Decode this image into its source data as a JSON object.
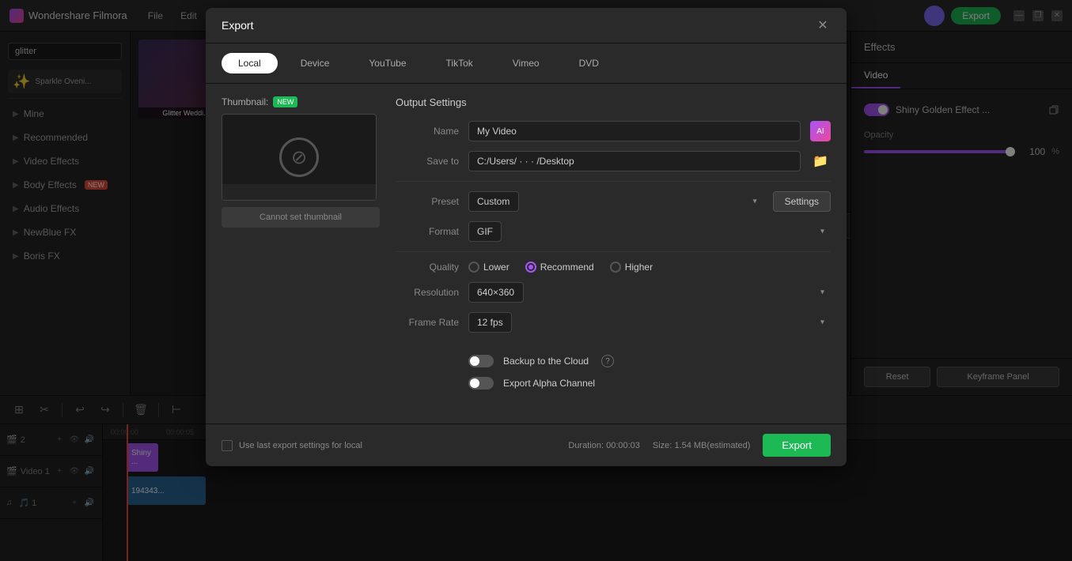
{
  "app": {
    "name": "Wondershare Filmora",
    "menu_items": [
      "File",
      "Edit"
    ]
  },
  "top_bar": {
    "export_button": "Export",
    "window_controls": [
      "—",
      "❐",
      "✕"
    ]
  },
  "sidebar": {
    "items": [
      {
        "id": "mine",
        "label": "Mine",
        "has_arrow": true,
        "badge": null
      },
      {
        "id": "recommended",
        "label": "Recommended",
        "has_arrow": true,
        "badge": null
      },
      {
        "id": "video-effects",
        "label": "Video Effects",
        "has_arrow": true,
        "badge": null
      },
      {
        "id": "body-effects",
        "label": "Body Effects",
        "has_arrow": true,
        "badge": "NEW"
      },
      {
        "id": "audio-effects",
        "label": "Audio Effects",
        "has_arrow": true,
        "badge": null
      },
      {
        "id": "newblue-fx",
        "label": "NewBlue FX",
        "has_arrow": true,
        "badge": null
      },
      {
        "id": "boris-fx",
        "label": "Boris FX",
        "has_arrow": true,
        "badge": null
      }
    ]
  },
  "right_panel": {
    "header": "Effects",
    "tabs": [
      "Video"
    ],
    "effect_name": "Shiny Golden Effect ...",
    "opacity_label": "Opacity",
    "opacity_value": "100",
    "opacity_unit": "%"
  },
  "bottom_buttons": {
    "reset": "Reset",
    "keyframe": "Keyframe Panel"
  },
  "timeline": {
    "track1_label": "Video 1",
    "track1_icon": "🎬",
    "track2_label": "2",
    "clip1_label": "Shiny ...",
    "clip2_label": "194343..."
  },
  "export_modal": {
    "title": "Export",
    "close_icon": "✕",
    "tabs": [
      {
        "id": "local",
        "label": "Local",
        "active": true
      },
      {
        "id": "device",
        "label": "Device",
        "active": false
      },
      {
        "id": "youtube",
        "label": "YouTube",
        "active": false
      },
      {
        "id": "tiktok",
        "label": "TikTok",
        "active": false
      },
      {
        "id": "vimeo",
        "label": "Vimeo",
        "active": false
      },
      {
        "id": "dvd",
        "label": "DVD",
        "active": false
      }
    ],
    "thumbnail": {
      "label": "Thumbnail:",
      "badge": "NEW",
      "cannot_set_label": "Cannot set thumbnail"
    },
    "output": {
      "title": "Output Settings",
      "name_label": "Name",
      "name_value": "My Video",
      "ai_icon": "AI",
      "save_to_label": "Save to",
      "save_to_value": "C:/Users/ · · · /Desktop",
      "preset_label": "Preset",
      "preset_value": "Custom",
      "settings_btn": "Settings",
      "format_label": "Format",
      "format_value": "GIF",
      "quality_label": "Quality",
      "quality_options": [
        {
          "id": "lower",
          "label": "Lower",
          "checked": false
        },
        {
          "id": "recommend",
          "label": "Recommend",
          "checked": true
        },
        {
          "id": "higher",
          "label": "Higher",
          "checked": false
        }
      ],
      "resolution_label": "Resolution",
      "resolution_value": "640×360",
      "frame_rate_label": "Frame Rate",
      "frame_rate_value": "12 fps",
      "backup_label": "Backup to the Cloud",
      "export_alpha_label": "Export Alpha Channel"
    },
    "footer": {
      "use_last_settings_label": "Use last export settings for local",
      "duration_label": "Duration:",
      "duration_value": "00:00:03",
      "size_label": "Size:",
      "size_value": "1.54 MB(estimated)",
      "export_btn": "Export"
    }
  },
  "search": {
    "placeholder": "glitter",
    "value": "glitter"
  }
}
